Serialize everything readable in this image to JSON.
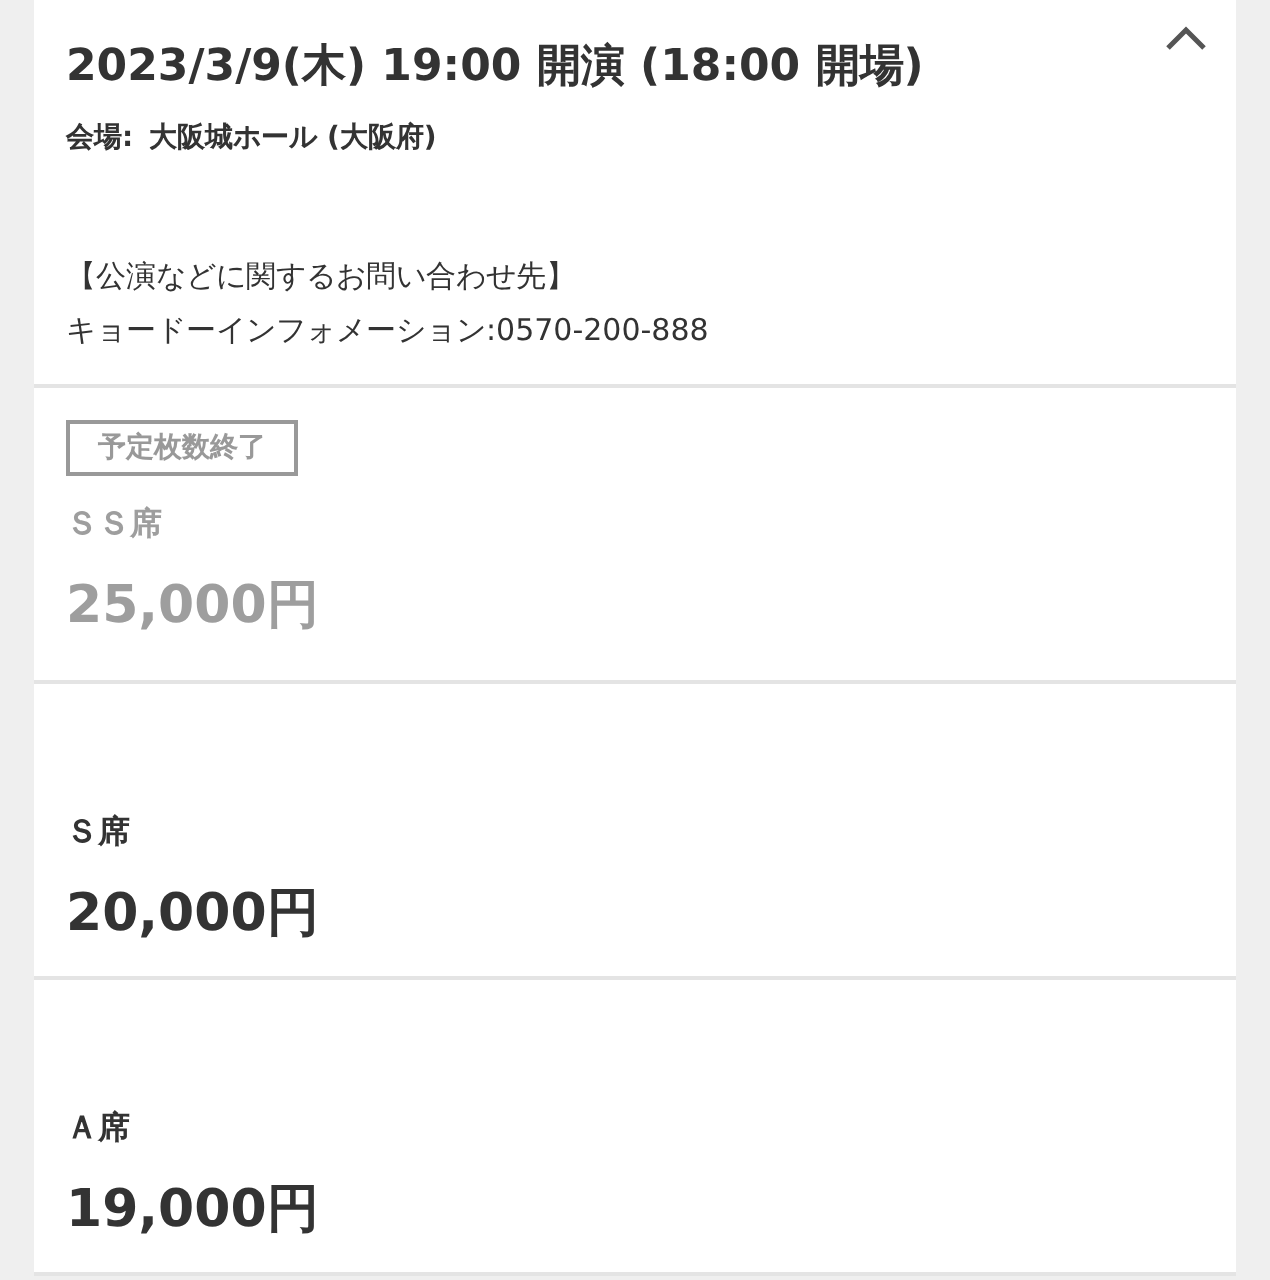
{
  "performance": {
    "title": "2023/3/9(木) 19:00 開演 (18:00 開場)",
    "expanded": true,
    "venue_label": "会場:",
    "venue": "大阪城ホール (大阪府)",
    "contact_lines": [
      "【公演などに関するお問い合わせ先】",
      "キョードーインフォメーション:0570-200-888"
    ]
  },
  "seats": [
    {
      "status_badge": "予定枚数終了",
      "sold_out": true,
      "name": "ＳＳ席",
      "price": "25,000円"
    },
    {
      "sold_out": false,
      "name": "Ｓ席",
      "price": "20,000円"
    },
    {
      "sold_out": false,
      "name": "Ａ席",
      "price": "19,000円"
    }
  ]
}
